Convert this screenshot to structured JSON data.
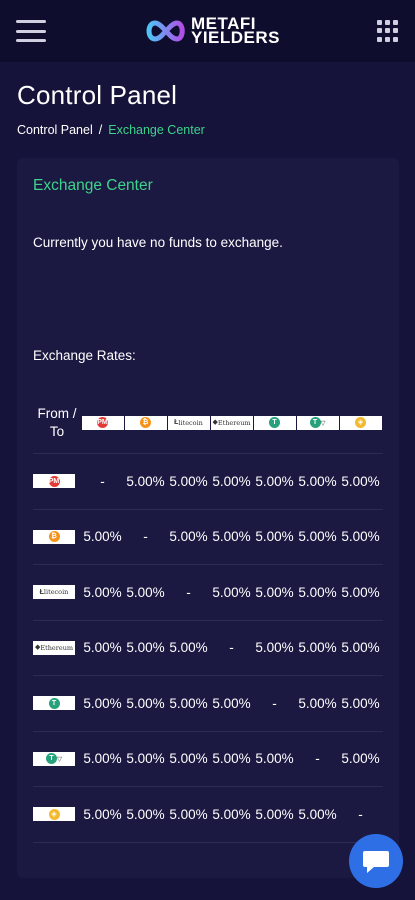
{
  "header": {
    "logo_line1": "METAFI",
    "logo_line2": "YIELDERS",
    "menu_icon": "hamburger-menu-icon",
    "apps_icon": "grid-apps-icon"
  },
  "page": {
    "title": "Control Panel",
    "breadcrumb": {
      "home": "Control Panel",
      "separator": "/",
      "current": "Exchange Center"
    }
  },
  "card": {
    "title": "Exchange Center",
    "message": "Currently you have no funds to exchange.",
    "rates_label": "Exchange Rates:"
  },
  "rates": {
    "corner_label_line1": "From /",
    "corner_label_line2": "To",
    "coins": [
      {
        "icon": "pm-coin-icon",
        "color": "#e53935",
        "glyph": "PM",
        "text": ""
      },
      {
        "icon": "bitcoin-coin-icon",
        "color": "#f7931a",
        "glyph": "₿",
        "text": ""
      },
      {
        "icon": "litecoin-coin-icon",
        "color": "#ffffff",
        "glyph": "Ł",
        "text": "litecoin"
      },
      {
        "icon": "ethereum-coin-icon",
        "color": "#ffffff",
        "glyph": "◆",
        "text": "Ethereum"
      },
      {
        "icon": "tether-coin-icon",
        "color": "#26a17b",
        "glyph": "T",
        "text": ""
      },
      {
        "icon": "tether-tron-coin-icon",
        "color": "#26a17b",
        "glyph": "T",
        "text": "▽"
      },
      {
        "icon": "bnb-coin-icon",
        "color": "#f3ba2f",
        "glyph": "◈",
        "text": ""
      }
    ],
    "rows": [
      [
        "-",
        "5.00%",
        "5.00%",
        "5.00%",
        "5.00%",
        "5.00%",
        "5.00%"
      ],
      [
        "5.00%",
        "-",
        "5.00%",
        "5.00%",
        "5.00%",
        "5.00%",
        "5.00%"
      ],
      [
        "5.00%",
        "5.00%",
        "-",
        "5.00%",
        "5.00%",
        "5.00%",
        "5.00%"
      ],
      [
        "5.00%",
        "5.00%",
        "5.00%",
        "-",
        "5.00%",
        "5.00%",
        "5.00%"
      ],
      [
        "5.00%",
        "5.00%",
        "5.00%",
        "5.00%",
        "-",
        "5.00%",
        "5.00%"
      ],
      [
        "5.00%",
        "5.00%",
        "5.00%",
        "5.00%",
        "5.00%",
        "-",
        "5.00%"
      ],
      [
        "5.00%",
        "5.00%",
        "5.00%",
        "5.00%",
        "5.00%",
        "5.00%",
        "-"
      ]
    ]
  },
  "chat": {
    "icon": "chat-bubble-icon",
    "color": "#2f6fe6"
  },
  "colors": {
    "accent": "#3dd38a",
    "background": "#15133a",
    "card": "#1b1942"
  }
}
